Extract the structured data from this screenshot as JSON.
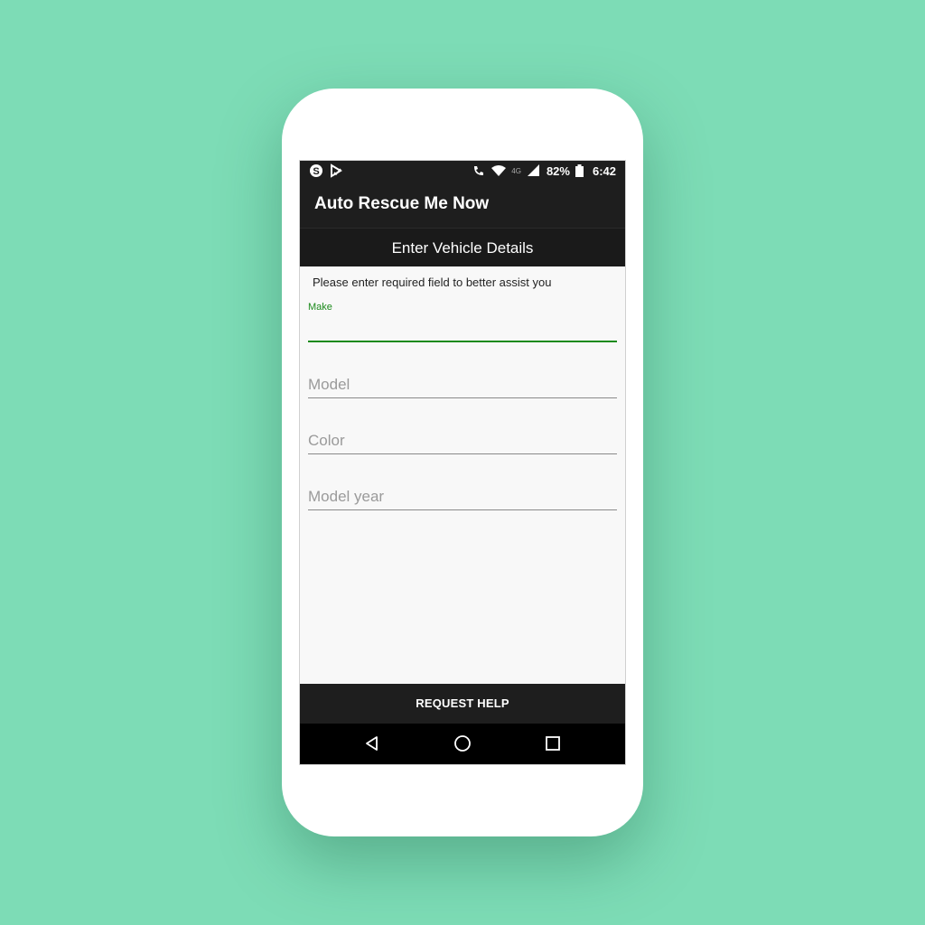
{
  "status_bar": {
    "battery": "82%",
    "time": "6:42",
    "network": "4G",
    "icons": [
      "skype-icon",
      "store-icon",
      "wifi-call-icon",
      "wifi-icon",
      "cellular-signal-icon",
      "battery-icon"
    ]
  },
  "app": {
    "title": "Auto Rescue Me Now"
  },
  "header": {
    "title": "Enter Vehicle Details"
  },
  "form": {
    "instruction": "Please enter required field to better assist you",
    "make_label": "Make",
    "make_value": "",
    "model_placeholder": "Model",
    "color_placeholder": "Color",
    "model_year_placeholder": "Model year"
  },
  "action": {
    "request_help_label": "REQUEST HELP"
  },
  "colors": {
    "background": "#7ddcb6",
    "bars": "#1e1e1e",
    "accent": "#1b8a1b"
  }
}
